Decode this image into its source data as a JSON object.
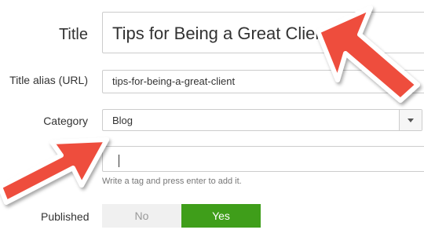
{
  "form": {
    "title_label": "Title",
    "title_value": "Tips for Being a Great Client",
    "alias_label": "Title alias (URL)",
    "alias_value": "tips-for-being-a-great-client",
    "category_label": "Category",
    "category_value": "Blog",
    "tag_hint": "Write a tag and press enter to add it.",
    "published_label": "Published",
    "published_no": "No",
    "published_yes": "Yes"
  },
  "annotations": {
    "arrow_color": "#ee4d3c",
    "icons": [
      "arrow-icon",
      "arrow-icon"
    ]
  },
  "colors": {
    "yes_active": "#3f9e1a",
    "no_inactive": "#f0f0f0"
  }
}
